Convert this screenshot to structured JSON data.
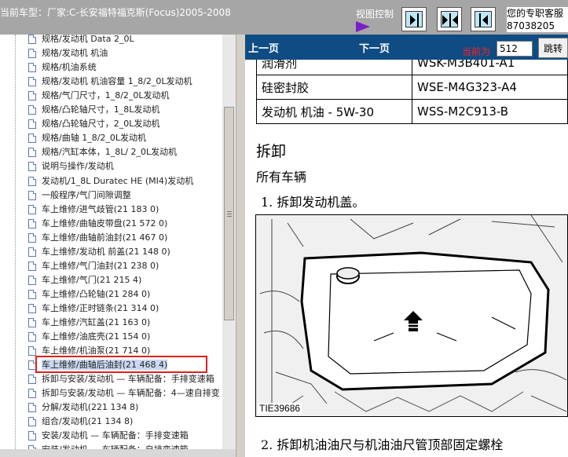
{
  "header": {
    "car_model": "当前车型：厂家:C-长安福特福克斯(Focus)2005-2008",
    "view_control_label": "视图控制",
    "hotline_line1": "您的专职客服",
    "hotline_line2": "87038205"
  },
  "tree": {
    "items": [
      "规格/发动机 Data 2_0L",
      "规格/发动机 机油",
      "规格/机油系统",
      "规格/发动机 机油容量 1_8/2_0L发动机",
      "规格/气门尺寸，1_8/2_0L发动机",
      "规格/凸轮轴尺寸，1_8L发动机",
      "规格/凸轮轴尺寸，2_0L发动机",
      "规格/曲轴 1_8/2_0L发动机",
      "规格/汽缸本体，1_8L/ 2_0L发动机",
      "说明与操作/发动机",
      "发动机/1_8L Duratec HE (MI4)发动机",
      "一般程序/气门间隙调整",
      "车上维修/进气歧管(21 183 0)",
      "车上维修/曲轴皮带盘(21 572 0)",
      "车上维修/曲轴前油封(21 467 0)",
      "车上维修/发动机 前盖(21 148 0)",
      "车上维修/气门油封(21 238 0)",
      "车上维修/气门(21 215 4)",
      "车上维修/凸轮轴(21 284 0)",
      "车上维修/正时链条(21 314 0)",
      "车上维修/汽缸盖(21 163 0)",
      "车上维修/油底壳(21 154 0)",
      "车上维修/机油泵(21 714 0)",
      "车上维修/曲轴后油封(21 468 4)",
      "拆卸与安装/发动机 — 车辆配备：手排变速箱",
      "拆卸与安装/发动机 — 车辆配备：4—速自排变",
      "分解/发动机(221 134 8)",
      "组合/发动机(21 134 8)",
      "安装/发动机 — 车辆配备：手排变速箱",
      "安装/发动机 — 车辆配备：自排变速箱"
    ],
    "selected_index": 23
  },
  "content": {
    "nav": {
      "prev": "上一页",
      "next": "下一页",
      "current_label": "当前为",
      "page_value": "512",
      "go_button": "跳转"
    },
    "spec_rows": [
      {
        "name": "润滑剂",
        "code": "WSK-M3B401-A1"
      },
      {
        "name": "硅密封胶",
        "code": "WSE-M4G323-A4"
      },
      {
        "name": "发动机 机油 - 5W-30",
        "code": "WSS-M2C913-B"
      }
    ],
    "section_title": "拆卸",
    "subtitle": "所有车辆",
    "step1": "1. 拆卸发动机盖。",
    "figure_caption": "TIE39686",
    "step2": "2. 拆卸机油油尺与机油油尺管顶部固定螺栓"
  },
  "colors": {
    "top_bar": "#a6a6a6",
    "nav_bar": "#0f4c84",
    "highlight_box": "#e02020",
    "current_label": "#ff2020"
  }
}
